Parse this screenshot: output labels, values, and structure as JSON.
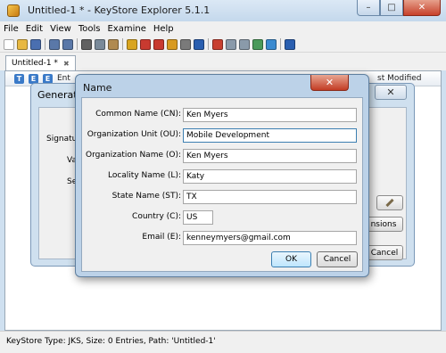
{
  "window": {
    "title": "Untitled-1 * - KeyStore Explorer 5.1.1",
    "minimize_glyph": "–",
    "maximize_glyph": "□",
    "close_glyph": "✕"
  },
  "menu": [
    "File",
    "Edit",
    "View",
    "Tools",
    "Examine",
    "Help"
  ],
  "toolbar_icons": [
    {
      "name": "new-icon",
      "color": "#ffffff"
    },
    {
      "name": "open-folder-icon",
      "color": "#e8b840"
    },
    {
      "name": "save-icon",
      "color": "#4a6fb0"
    },
    {
      "name": "undo-icon",
      "color": "#5a78a8"
    },
    {
      "name": "redo-icon",
      "color": "#5a78a8"
    },
    {
      "name": "cut-icon",
      "color": "#606060"
    },
    {
      "name": "copy-icon",
      "color": "#7a8a9a"
    },
    {
      "name": "paste-icon",
      "color": "#b08a50"
    },
    {
      "name": "generate-keypair-icon",
      "color": "#d9a520"
    },
    {
      "name": "generate-secret-key-icon",
      "color": "#c83a30"
    },
    {
      "name": "import-trusted-cert-icon",
      "color": "#c83a30"
    },
    {
      "name": "import-keypair-icon",
      "color": "#d89a20"
    },
    {
      "name": "set-password-icon",
      "color": "#7a7a7a"
    },
    {
      "name": "properties-icon",
      "color": "#2a5fb0"
    },
    {
      "name": "examine-file-icon",
      "color": "#c84030"
    },
    {
      "name": "examine-clipboard-icon",
      "color": "#8a9aaa"
    },
    {
      "name": "examine-ssl-icon",
      "color": "#8a9aaa"
    },
    {
      "name": "examine-csr-icon",
      "color": "#4a9a5a"
    },
    {
      "name": "examine-crl-icon",
      "color": "#3a8ad0"
    },
    {
      "name": "help-icon",
      "color": "#2a5fb0"
    }
  ],
  "tab": {
    "label": "Untitled-1 *",
    "close_glyph": "✖"
  },
  "table_header": {
    "icons": [
      {
        "glyph": "T",
        "color": "#3a7ac8"
      },
      {
        "glyph": "E",
        "color": "#3a7ac8"
      },
      {
        "glyph": "E",
        "color": "#3a7ac8"
      }
    ],
    "entry_label": "Ent",
    "last_modified": "st Modified"
  },
  "generate_dialog": {
    "title": "Generate",
    "close_glyph": "✕",
    "labels": [
      "Signature",
      "Vali",
      "Seri"
    ],
    "extensions_button": "nsions",
    "cancel_button": "Cancel"
  },
  "name_dialog": {
    "title": "Name",
    "close_glyph": "✕",
    "fields": [
      {
        "label": "Common Name (CN):",
        "value": "Ken Myers"
      },
      {
        "label": "Organization Unit (OU):",
        "value": "Mobile Development"
      },
      {
        "label": "Organization Name (O):",
        "value": "Ken Myers"
      },
      {
        "label": "Locality Name (L):",
        "value": "Katy"
      },
      {
        "label": "State Name (ST):",
        "value": "TX"
      },
      {
        "label": "Country (C):",
        "value": "US"
      },
      {
        "label": "Email (E):",
        "value": "kenneymyers@gmail.com"
      }
    ],
    "ok_button": "OK",
    "cancel_button": "Cancel"
  },
  "status": "KeyStore Type: JKS, Size: 0 Entries, Path: 'Untitled-1'"
}
